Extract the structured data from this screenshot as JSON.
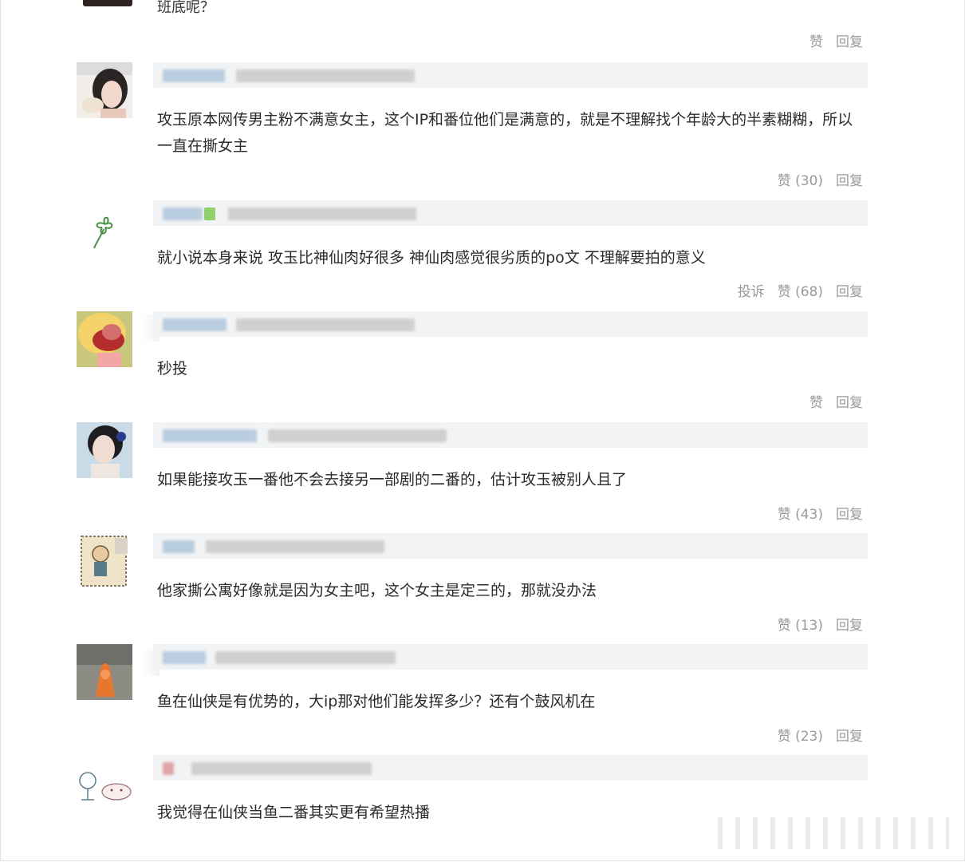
{
  "top_comment": {
    "text": "班底呢？",
    "actions": {
      "like": "赞",
      "reply": "回复"
    }
  },
  "comments": [
    {
      "text": "攻玉原本网传男主粉不满意女主，这个IP和番位他们是满意的，就是不理解找个年龄大的半素糊糊，所以一直在撕女主",
      "like": "赞 (30)",
      "reply": "回复",
      "avatar_icon": "girl-photo-avatar-icon"
    },
    {
      "text": "就小说本身来说 攻玉比神仙肉好很多 神仙肉感觉很劣质的po文 不理解要拍的意义",
      "report": "投诉",
      "like": "赞 (68)",
      "reply": "回复",
      "avatar_icon": "clover-avatar-icon"
    },
    {
      "text": "秒投",
      "like": "赞",
      "reply": "回复",
      "avatar_icon": "plush-toy-avatar-icon"
    },
    {
      "text": "如果能接攻玉一番他不会去接另一部剧的二番的，估计攻玉被别人且了",
      "like": "赞 (43)",
      "reply": "回复",
      "avatar_icon": "woman-portrait-avatar-icon"
    },
    {
      "text": "他家撕公寓好像就是因为女主吧，这个女主是定三的，那就没办法",
      "like": "赞 (13)",
      "reply": "回复",
      "avatar_icon": "cartoon-stamp-avatar-icon"
    },
    {
      "text": "鱼在仙侠是有优势的，大ip那对他们能发挥多少？还有个鼓风机在",
      "like": "赞 (23)",
      "reply": "回复",
      "avatar_icon": "orange-toy-avatar-icon"
    },
    {
      "text": "我觉得在仙侠当鱼二番其实更有希望热播",
      "avatar_icon": "fan-sketch-avatar-icon"
    }
  ],
  "colors": {
    "header_bar": "#f1f3f4",
    "action_text": "#9a9a9a",
    "body_text": "#2b2b2b"
  }
}
